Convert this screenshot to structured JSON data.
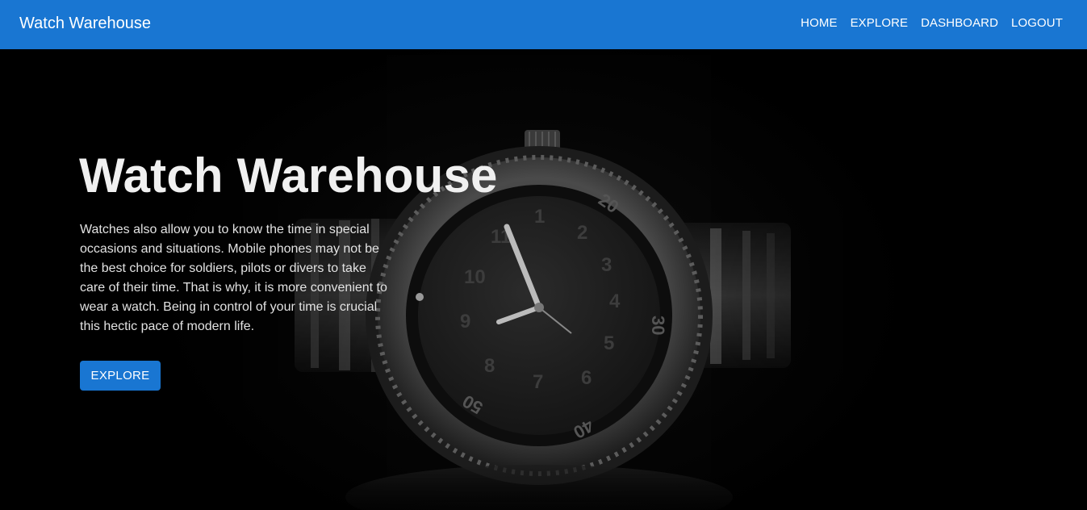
{
  "header": {
    "brand": "Watch Warehouse",
    "nav": [
      {
        "label": "HOME"
      },
      {
        "label": "EXPLORE"
      },
      {
        "label": "DASHBOARD"
      },
      {
        "label": "LOGOUT"
      }
    ]
  },
  "hero": {
    "title": "Watch Warehouse",
    "description": "Watches also allow you to know the time in special occasions and situations. Mobile phones may not be the best choice for soldiers, pilots or divers to take care of their time. That is why, it is more convenient to wear a watch. Being in control of your time is crucial this hectic pace of modern life.",
    "button_label": "EXPLORE",
    "image": "wristwatch-photo"
  },
  "colors": {
    "primary": "#1976d2",
    "hero_background": "#000000"
  }
}
